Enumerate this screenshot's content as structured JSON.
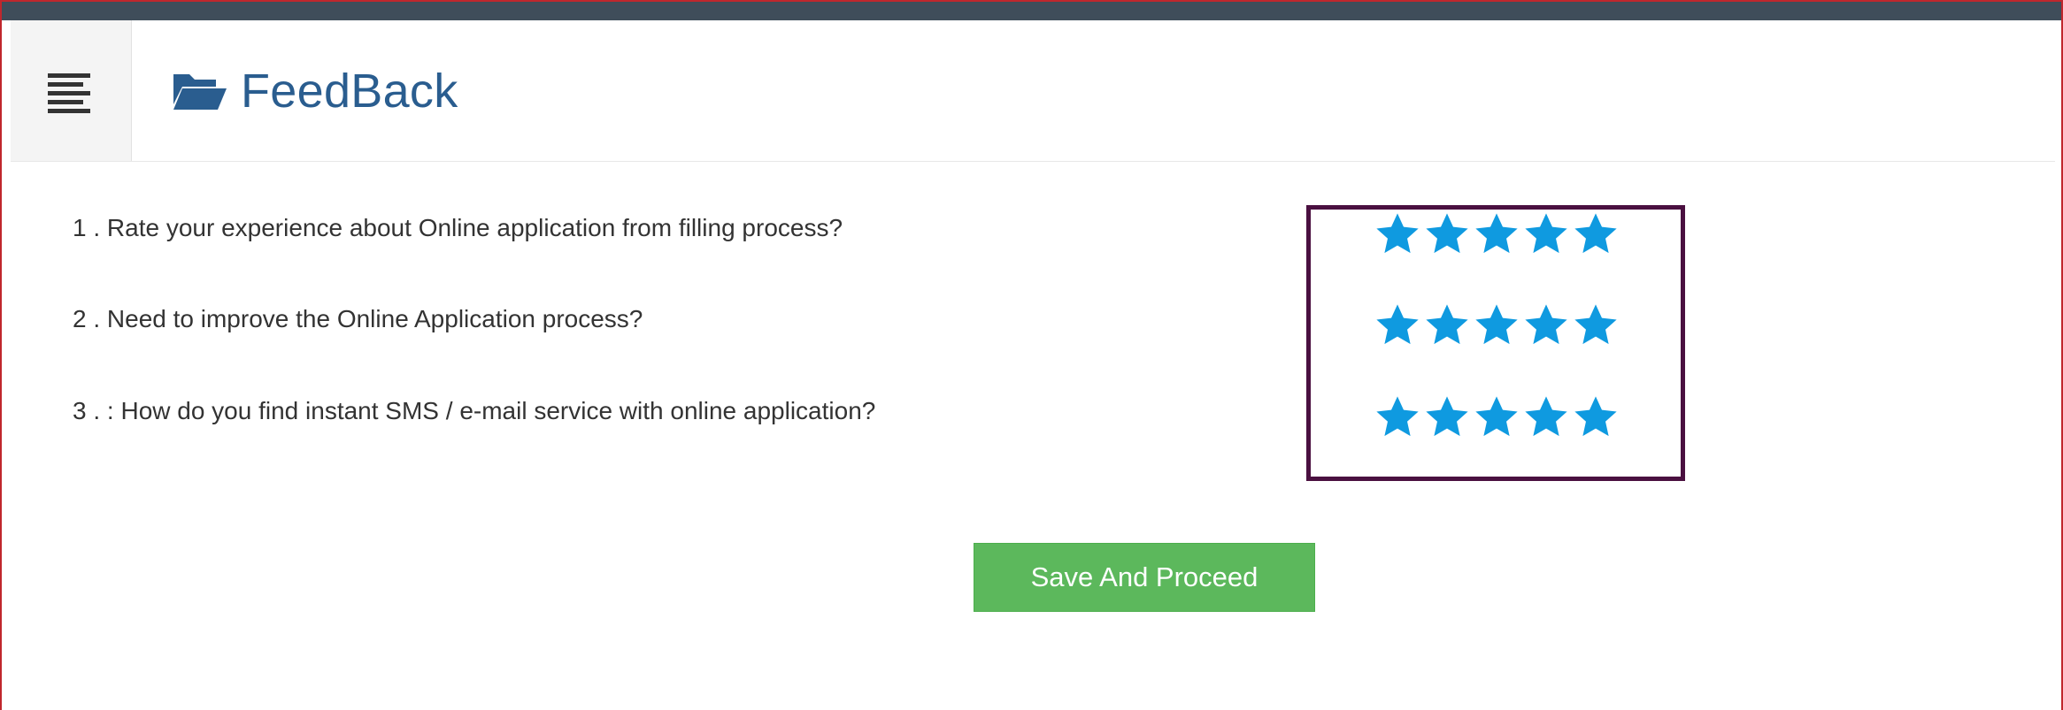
{
  "header": {
    "menu_icon": "hamburger-menu-icon",
    "title_icon": "folder-open-icon",
    "title": "FeedBack"
  },
  "questions": [
    {
      "text": "1 . Rate your experience about Online application from filling process?",
      "rating": {
        "max": 5,
        "selected": 5
      }
    },
    {
      "text": "2 . Need to improve the Online Application process?",
      "rating": {
        "max": 5,
        "selected": 5
      }
    },
    {
      "text": "3 . : How do you find instant SMS / e-mail service with online application?",
      "rating": {
        "max": 5,
        "selected": 5
      }
    }
  ],
  "actions": {
    "save_label": "Save And Proceed"
  },
  "colors": {
    "top_strip": "#3f4d5a",
    "frame_border": "#c0272d",
    "title": "#2a5d8f",
    "star": "#0f9ae0",
    "rating_box_border": "#4a1040",
    "save_button": "#5cb85c"
  }
}
